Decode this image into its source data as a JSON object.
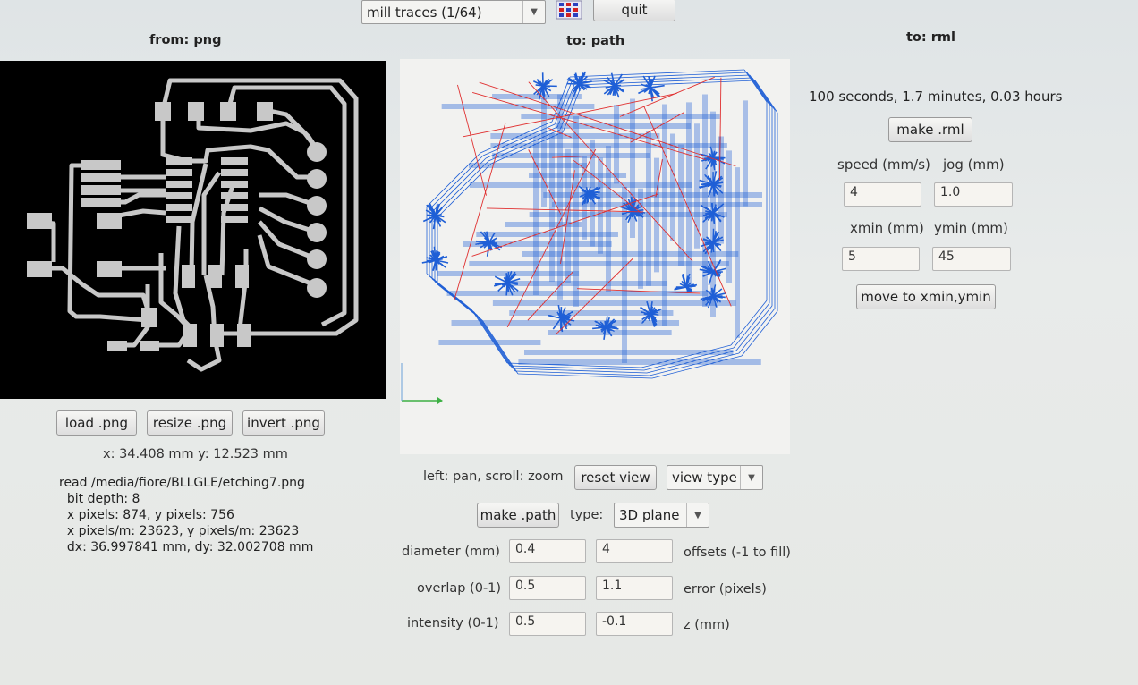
{
  "toolbar": {
    "mode_select": "mill traces (1/64)",
    "quit_label": "quit"
  },
  "panels": {
    "from": "from: png",
    "to_path": "to: path",
    "to_rml": "to: rml"
  },
  "png": {
    "load_label": "load .png",
    "resize_label": "resize .png",
    "invert_label": "invert .png",
    "coords": "x: 34.408 mm  y: 12.523 mm",
    "info_lines": [
      "read /media/fiore/BLLGLE/etching7.png",
      "  bit depth: 8",
      "  x pixels: 874, y pixels: 756",
      "  x pixels/m: 23623, y pixels/m: 23623",
      "  dx: 36.997841 mm, dy: 32.002708 mm"
    ]
  },
  "path": {
    "view_hint": "left: pan, scroll: zoom",
    "reset_view_label": "reset view",
    "view_type_label": "view type",
    "make_path_label": "make .path",
    "type_label": "type:",
    "type_value": "3D plane",
    "diameter_label": "diameter (mm)",
    "diameter_value": "0.4",
    "offsets_value": "4",
    "offsets_label": "offsets (-1 to fill)",
    "overlap_label": "overlap (0-1)",
    "overlap_value": "0.5",
    "error_value": "1.1",
    "error_label": "error (pixels)",
    "intensity_label": "intensity (0-1)",
    "intensity_value": "0.5",
    "z_value": "-0.1",
    "z_label": "z (mm)"
  },
  "rml": {
    "time": "100 seconds, 1.7 minutes, 0.03 hours",
    "make_rml_label": "make .rml",
    "speed_label": "speed (mm/s)",
    "jog_label": "jog (mm)",
    "speed_value": "4",
    "jog_value": "1.0",
    "xmin_label": "xmin (mm)",
    "ymin_label": "ymin (mm)",
    "xmin_value": "5",
    "ymin_value": "45",
    "move_label": "move to xmin,ymin"
  },
  "colors": {
    "trace": "#c8c8c8",
    "path_blue": "#1f5fd6",
    "path_red": "#e03030",
    "axis_green": "#3cb043"
  }
}
